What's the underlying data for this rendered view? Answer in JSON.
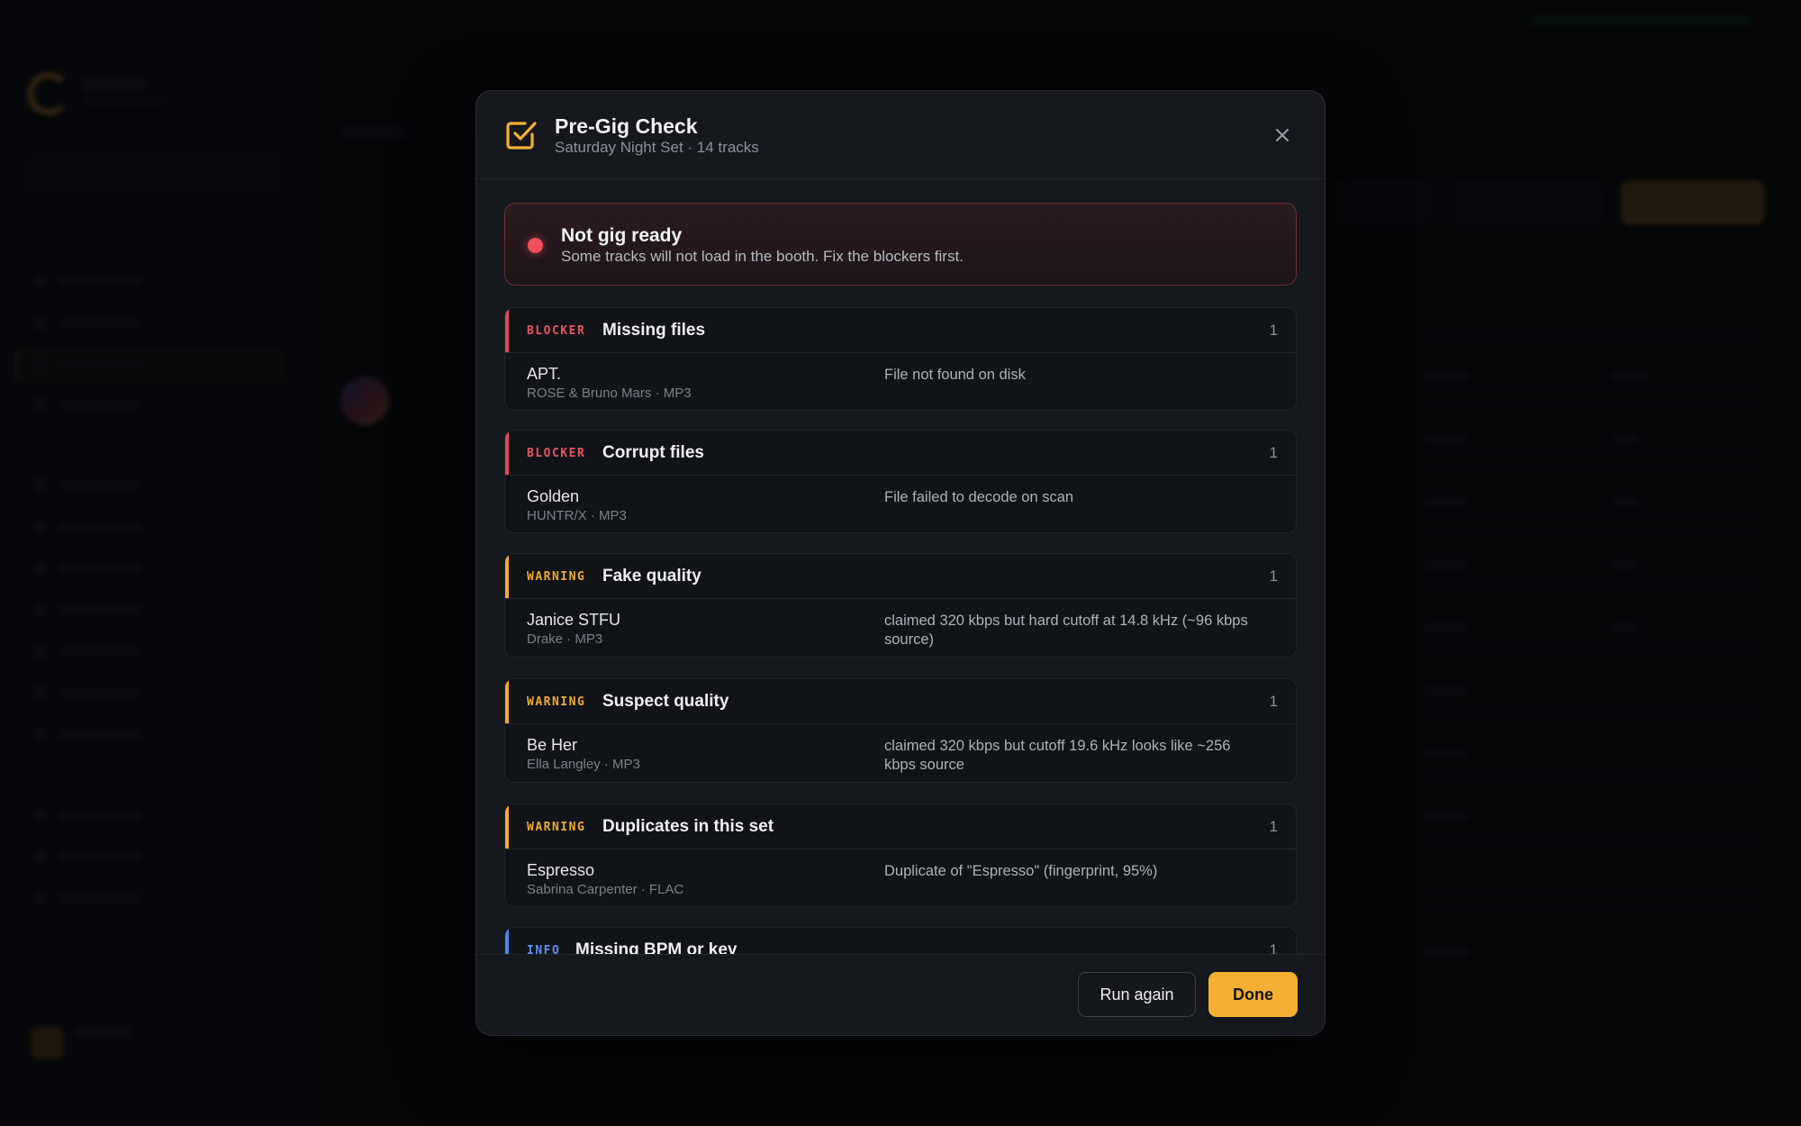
{
  "modal": {
    "title": "Pre-Gig Check",
    "subtitle": "Saturday Night Set · 14 tracks",
    "icon": "checkbox-check-icon",
    "accent_color": "#f5b033"
  },
  "status": {
    "title": "Not gig ready",
    "description": "Some tracks will not load in the booth. Fix the blockers first.",
    "color": "#f0505a"
  },
  "issues": [
    {
      "severity": "BLOCKER",
      "title": "Missing files",
      "count": "1",
      "track": "APT.",
      "meta": "ROSE & Bruno Mars · MP3",
      "reason": "File not found on disk"
    },
    {
      "severity": "BLOCKER",
      "title": "Corrupt files",
      "count": "1",
      "track": "Golden",
      "meta": "HUNTR/X · MP3",
      "reason": "File failed to decode on scan"
    },
    {
      "severity": "WARNING",
      "title": "Fake quality",
      "count": "1",
      "track": "Janice STFU",
      "meta": "Drake · MP3",
      "reason": "claimed 320 kbps but hard cutoff at 14.8 kHz (~96 kbps source)"
    },
    {
      "severity": "WARNING",
      "title": "Suspect quality",
      "count": "1",
      "track": "Be Her",
      "meta": "Ella Langley · MP3",
      "reason": "claimed 320 kbps but cutoff 19.6 kHz looks like ~256 kbps source"
    },
    {
      "severity": "WARNING",
      "title": "Duplicates in this set",
      "count": "1",
      "track": "Espresso",
      "meta": "Sabrina Carpenter · FLAC",
      "reason": "Duplicate of \"Espresso\" (fingerprint, 95%)"
    },
    {
      "severity": "INFO",
      "title": "Missing BPM or key",
      "count": "1"
    }
  ],
  "footer": {
    "run_again_label": "Run again",
    "done_label": "Done"
  }
}
